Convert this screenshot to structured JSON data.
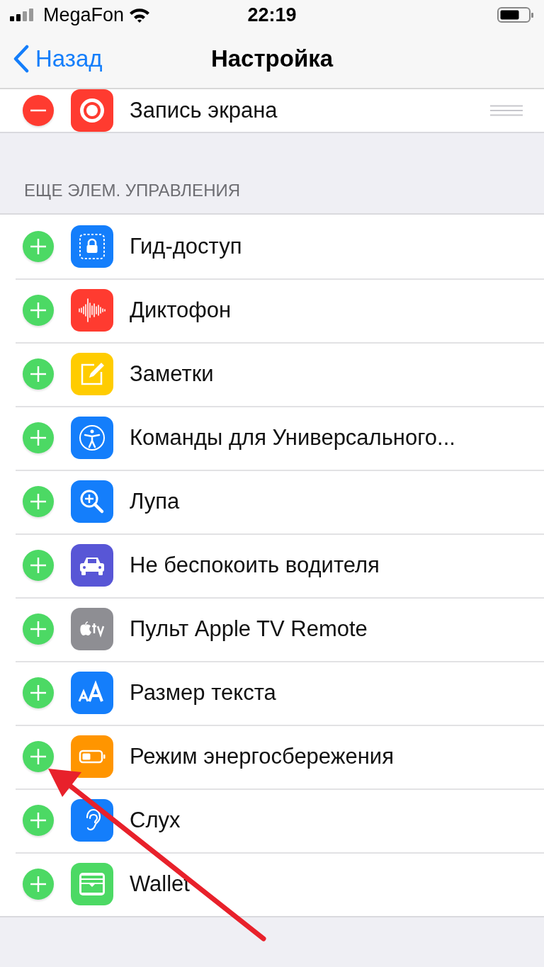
{
  "status_bar": {
    "carrier": "MegaFon",
    "time": "22:19"
  },
  "nav_bar": {
    "back": "Назад",
    "title": "Настройка"
  },
  "included": [
    {
      "label": "Запись экрана",
      "kind": "record",
      "included": true
    }
  ],
  "more_section": {
    "header": "ЕЩЕ ЭЛЕМ. УПРАВЛЕНИЯ",
    "rows": [
      {
        "label": "Гид-доступ",
        "kind": "guided-access",
        "included": false
      },
      {
        "label": "Диктофон",
        "kind": "voice-memo",
        "included": false
      },
      {
        "label": "Заметки",
        "kind": "notes",
        "included": false
      },
      {
        "label": "Команды для Универсального...",
        "kind": "accessibility",
        "included": false
      },
      {
        "label": "Лупа",
        "kind": "magnifier",
        "included": false
      },
      {
        "label": "Не беспокоить водителя",
        "kind": "driving",
        "included": false
      },
      {
        "label": "Пульт Apple TV Remote",
        "kind": "tv-remote",
        "included": false
      },
      {
        "label": "Размер текста",
        "kind": "text-size",
        "included": false
      },
      {
        "label": "Режим энергосбережения",
        "kind": "low-power",
        "included": false
      },
      {
        "label": "Слух",
        "kind": "hearing",
        "included": false
      },
      {
        "label": "Wallet",
        "kind": "wallet",
        "included": false
      }
    ]
  },
  "annotations": [
    {
      "kind": "arrow"
    }
  ]
}
